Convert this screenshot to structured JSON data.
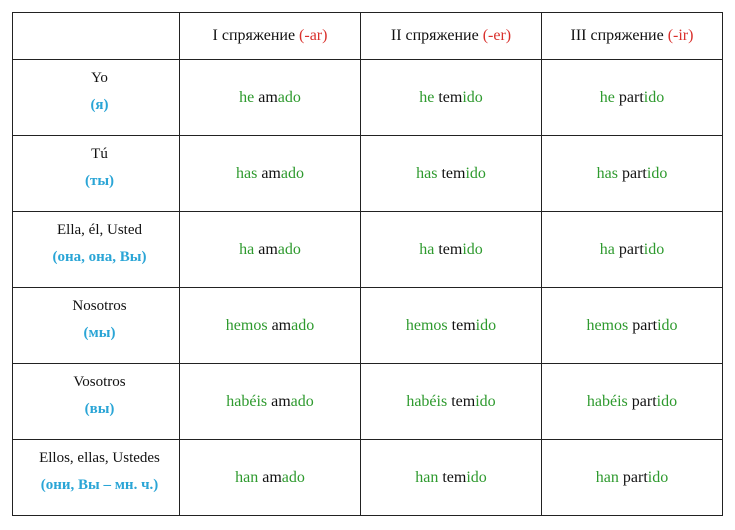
{
  "colors": {
    "green": "#2e9a2e",
    "red": "#d9302c",
    "blue": "#2aa5d6",
    "text": "#111111"
  },
  "header": [
    {
      "label": "I спряжение ",
      "ending": "(-ar)"
    },
    {
      "label": "II спряжение ",
      "ending": "(-er)"
    },
    {
      "label": "III спряжение ",
      "ending": "(-ir)"
    }
  ],
  "rows": [
    {
      "pronoun": "Yo",
      "translation": "(я)",
      "forms": [
        {
          "aux": "he",
          "stem": " am",
          "end": "ado"
        },
        {
          "aux": "he",
          "stem": " tem",
          "end": "ido"
        },
        {
          "aux": "he",
          "stem": " part",
          "end": "ido"
        }
      ]
    },
    {
      "pronoun": "Tú",
      "translation": "(ты)",
      "forms": [
        {
          "aux": "has",
          "stem": " am",
          "end": "ado"
        },
        {
          "aux": "has",
          "stem": " tem",
          "end": "ido"
        },
        {
          "aux": "has",
          "stem": " part",
          "end": "ido"
        }
      ]
    },
    {
      "pronoun": "Ella, él, Usted",
      "translation": "(она, она, Вы)",
      "forms": [
        {
          "aux": "ha",
          "stem": " am",
          "end": "ado"
        },
        {
          "aux": "ha",
          "stem": " tem",
          "end": "ido"
        },
        {
          "aux": "ha",
          "stem": " part",
          "end": "ido"
        }
      ]
    },
    {
      "pronoun": "Nosotros",
      "translation": "(мы)",
      "forms": [
        {
          "aux": "hemos",
          "stem": " am",
          "end": "ado"
        },
        {
          "aux": "hemos",
          "stem": " tem",
          "end": "ido"
        },
        {
          "aux": "hemos",
          "stem": " part",
          "end": "ido"
        }
      ]
    },
    {
      "pronoun": "Vosotros",
      "translation": "(вы)",
      "forms": [
        {
          "aux": "habéis",
          "stem": " am",
          "end": "ado"
        },
        {
          "aux": "habéis",
          "stem": " tem",
          "end": "ido"
        },
        {
          "aux": "habéis",
          "stem": " part",
          "end": "ido"
        }
      ]
    },
    {
      "pronoun": "Ellos, ellas, Ustedes",
      "translation": "(они, Вы – мн. ч.)",
      "forms": [
        {
          "aux": "han",
          "stem": " am",
          "end": "ado"
        },
        {
          "aux": "han",
          "stem": " tem",
          "end": "ido"
        },
        {
          "aux": "han",
          "stem": " part",
          "end": "ido"
        }
      ]
    }
  ]
}
